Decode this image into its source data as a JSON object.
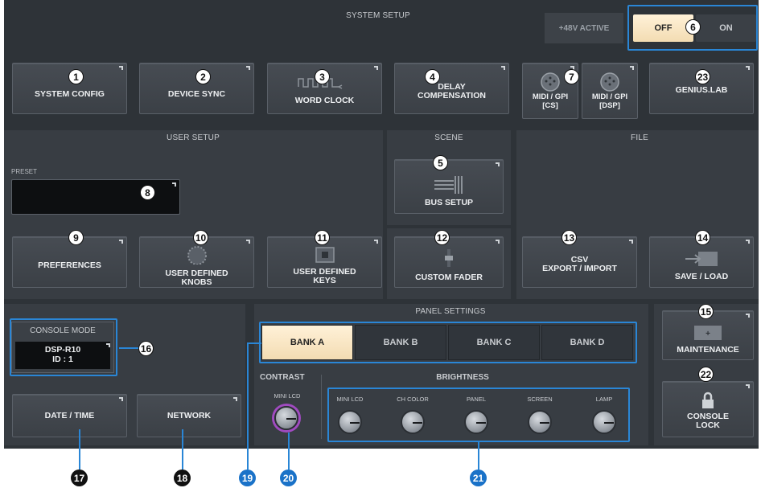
{
  "system_setup": {
    "title": "SYSTEM SETUP",
    "phantom_label": "+48V ACTIVE",
    "off_label": "OFF",
    "on_label": "ON"
  },
  "buttons": {
    "system_config": "SYSTEM CONFIG",
    "device_sync": "DEVICE SYNC",
    "word_clock": "WORD CLOCK",
    "delay_comp_1": "DELAY",
    "delay_comp_2": "COMPENSATION",
    "midi_cs_1": "MIDI / GPI",
    "midi_cs_2": "[CS]",
    "midi_dsp_1": "MIDI / GPI",
    "midi_dsp_2": "[DSP]",
    "genius_lab": "GENIUS.LAB",
    "bus_setup": "BUS SETUP",
    "preferences": "PREFERENCES",
    "user_knobs_1": "USER DEFINED",
    "user_knobs_2": "KNOBS",
    "user_keys_1": "USER DEFINED",
    "user_keys_2": "KEYS",
    "custom_fader": "CUSTOM FADER",
    "csv_1": "CSV",
    "csv_2": "EXPORT / IMPORT",
    "save_load": "SAVE / LOAD",
    "maintenance": "MAINTENANCE",
    "console_lock_1": "CONSOLE",
    "console_lock_2": "LOCK",
    "date_time": "DATE / TIME",
    "network": "NETWORK"
  },
  "user_setup": {
    "title": "USER SETUP",
    "preset_label": "PRESET"
  },
  "scene": {
    "title": "SCENE"
  },
  "file": {
    "title": "FILE"
  },
  "console_mode": {
    "title": "CONSOLE MODE",
    "model": "DSP-R10",
    "id": "ID : 1"
  },
  "panel_settings": {
    "title": "PANEL SETTINGS",
    "banks": [
      "BANK A",
      "BANK B",
      "BANK C",
      "BANK D"
    ],
    "contrast_label": "CONTRAST",
    "contrast_knob": "MINI LCD",
    "brightness_label": "BRIGHTNESS",
    "brightness_knobs": [
      "MINI LCD",
      "CH COLOR",
      "PANEL",
      "SCREEN",
      "LAMP"
    ]
  },
  "callouts": {
    "n1": "1",
    "n2": "2",
    "n3": "3",
    "n4": "4",
    "n5": "5",
    "n6": "6",
    "n7": "7",
    "n8": "8",
    "n9": "9",
    "n10": "10",
    "n11": "11",
    "n12": "12",
    "n13": "13",
    "n14": "14",
    "n15": "15",
    "n16": "16",
    "n17": "17",
    "n18": "18",
    "n19": "19",
    "n20": "20",
    "n21": "21",
    "n22": "22",
    "n23": "23"
  },
  "colors": {
    "accent": "#2a86d6",
    "screen_bg": "#2e3338",
    "panel_bg": "#383d43",
    "active_bank": "#f3dcb2"
  }
}
